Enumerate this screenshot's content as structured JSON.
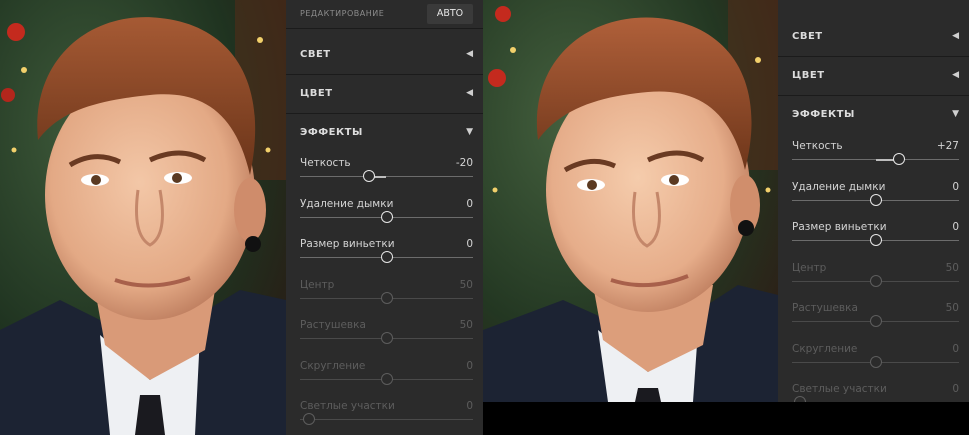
{
  "left": {
    "header": {
      "label": "РЕДАКТИРОВАНИЕ",
      "auto_button": "АВТО"
    },
    "sections": [
      {
        "label": "СВЕТ",
        "state": "collapsed"
      },
      {
        "label": "ЦВЕТ",
        "state": "collapsed"
      },
      {
        "label": "ЭФФЕКТЫ",
        "state": "expanded"
      }
    ],
    "sliders": [
      {
        "label": "Четкость",
        "value": "-20",
        "fraction": 0.4,
        "enabled": true
      },
      {
        "label": "Удаление дымки",
        "value": "0",
        "fraction": 0.5,
        "enabled": true
      },
      {
        "label": "Размер виньетки",
        "value": "0",
        "fraction": 0.5,
        "enabled": true
      },
      {
        "label": "Центр",
        "value": "50",
        "fraction": 0.5,
        "enabled": false
      },
      {
        "label": "Растушевка",
        "value": "50",
        "fraction": 0.5,
        "enabled": false
      },
      {
        "label": "Скругление",
        "value": "0",
        "fraction": 0.5,
        "enabled": false
      },
      {
        "label": "Светлые участки",
        "value": "0",
        "fraction": 0.05,
        "enabled": false
      }
    ]
  },
  "right": {
    "sections": [
      {
        "label": "СВЕТ",
        "state": "collapsed"
      },
      {
        "label": "ЦВЕТ",
        "state": "collapsed"
      },
      {
        "label": "ЭФФЕКТЫ",
        "state": "expanded"
      }
    ],
    "sliders": [
      {
        "label": "Четкость",
        "value": "+27",
        "fraction": 0.64,
        "enabled": true
      },
      {
        "label": "Удаление дымки",
        "value": "0",
        "fraction": 0.5,
        "enabled": true
      },
      {
        "label": "Размер виньетки",
        "value": "0",
        "fraction": 0.5,
        "enabled": true
      },
      {
        "label": "Центр",
        "value": "50",
        "fraction": 0.5,
        "enabled": false
      },
      {
        "label": "Растушевка",
        "value": "50",
        "fraction": 0.5,
        "enabled": false
      },
      {
        "label": "Скругление",
        "value": "0",
        "fraction": 0.5,
        "enabled": false
      },
      {
        "label": "Светлые участки",
        "value": "0",
        "fraction": 0.05,
        "enabled": false
      }
    ]
  },
  "icons": {
    "collapsed": "chevron-left-icon",
    "expanded": "chevron-down-icon"
  },
  "colors": {
    "panel_bg": "#2b2b2b",
    "text": "#d8d8d8",
    "dim_text": "#5d5d5d"
  }
}
